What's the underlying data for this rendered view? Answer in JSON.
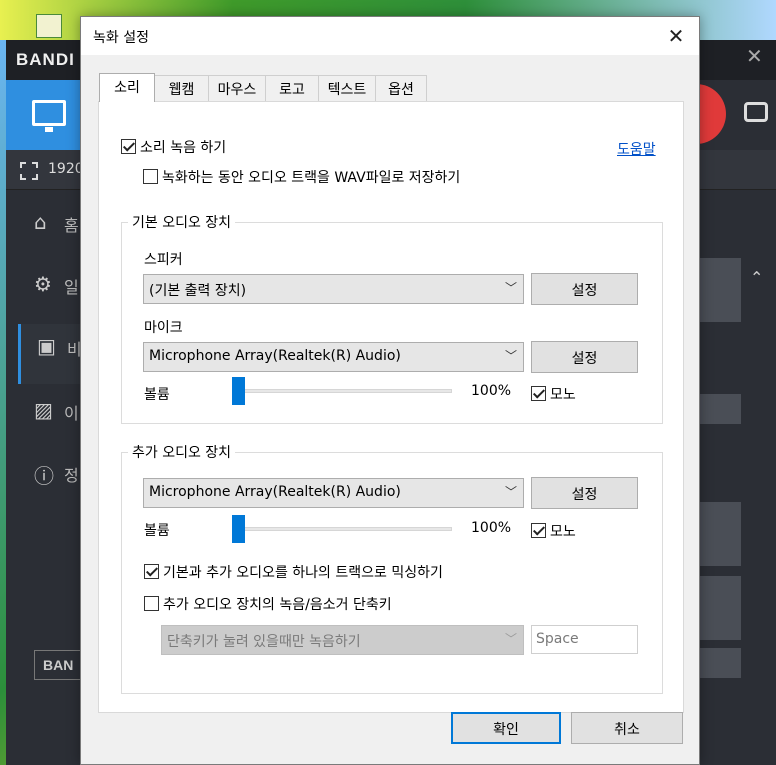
{
  "background_app": {
    "logo": "BANDI",
    "resolution": "1920",
    "sidebar": [
      {
        "label": "홈",
        "icon": "home-icon"
      },
      {
        "label": "일",
        "icon": "gear-icon"
      },
      {
        "label": "비",
        "icon": "video-settings-icon"
      },
      {
        "label": "이",
        "icon": "image-settings-icon"
      },
      {
        "label": "정",
        "icon": "info-icon"
      }
    ],
    "bottom_logo": "BAN"
  },
  "dialog": {
    "title": "녹화 설정",
    "close_glyph": "✕",
    "tabs": [
      "소리",
      "웹캠",
      "마우스",
      "로고",
      "텍스트",
      "옵션"
    ],
    "active_tab": 0,
    "record_sound": {
      "label": "소리 녹음 하기",
      "checked": true
    },
    "help_link": "도움말",
    "save_wav": {
      "label": "녹화하는 동안 오디오 트랙을 WAV파일로 저장하기",
      "checked": false
    },
    "primary_device": {
      "group_title": "기본 오디오 장치",
      "speaker_label": "스피커",
      "speaker_value": "(기본 출력 장치)",
      "speaker_settings": "설정",
      "mic_label": "마이크",
      "mic_value": "Microphone Array(Realtek(R) Audio)",
      "mic_settings": "설정",
      "volume_label": "볼륨",
      "volume_percent": "100%",
      "volume_level": 0.0,
      "mono": {
        "label": "모노",
        "checked": true
      }
    },
    "secondary_device": {
      "group_title": "추가 오디오 장치",
      "device_value": "Microphone Array(Realtek(R) Audio)",
      "device_settings": "설정",
      "volume_label": "볼륨",
      "volume_percent": "100%",
      "volume_level": 0.0,
      "mono": {
        "label": "모노",
        "checked": true
      },
      "mix": {
        "label": "기본과 추가 오디오를 하나의 트랙으로 믹싱하기",
        "checked": true
      },
      "hotkey": {
        "label": "추가 오디오 장치의 녹음/음소거 단축키",
        "checked": false
      },
      "hotkey_mode": "단축키가 눌려 있을때만 녹음하기",
      "hotkey_key": "Space"
    },
    "ok_button": "확인",
    "cancel_button": "취소"
  },
  "colors": {
    "accent": "#0078d7",
    "link": "#0050c8",
    "bandicam_blue": "#2f8fe0",
    "record_red": "#e03a3a"
  }
}
